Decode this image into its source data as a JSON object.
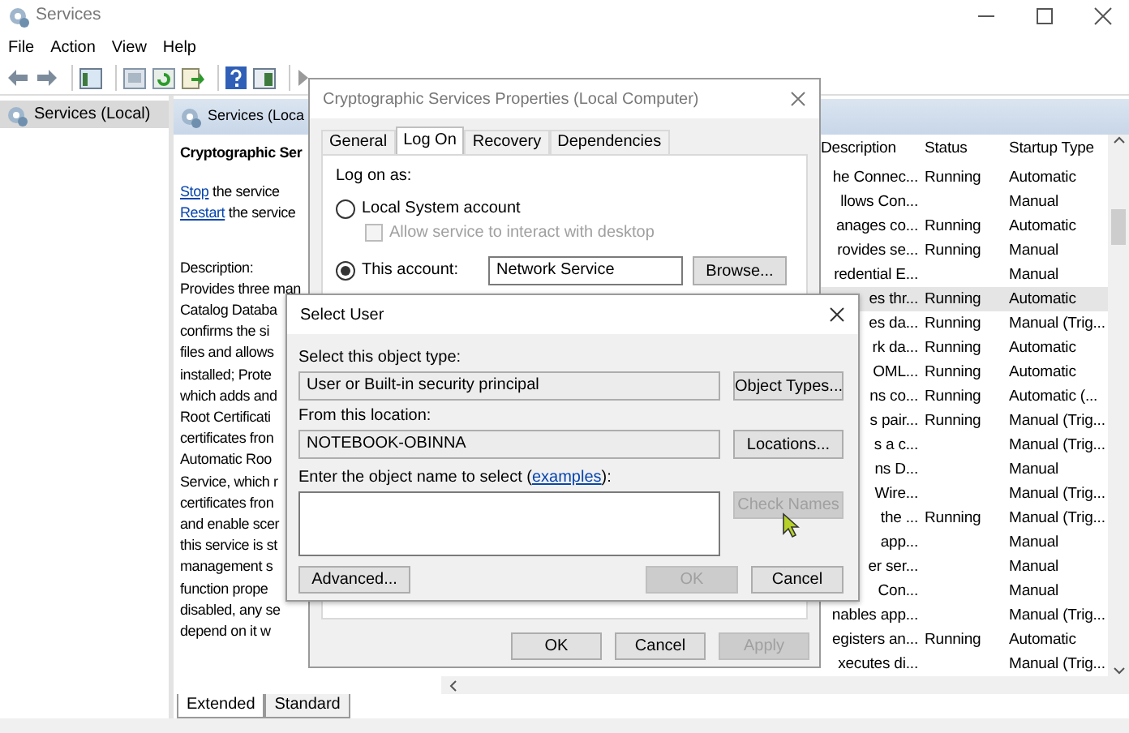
{
  "window": {
    "title": "Services"
  },
  "menu": [
    "File",
    "Action",
    "View",
    "Help"
  ],
  "tree": {
    "items": [
      {
        "label": "Services (Local)",
        "selected": true
      }
    ]
  },
  "pane_header": "Services (Loca",
  "details": {
    "title": "Cryptographic Ser",
    "actions": [
      {
        "link": "Stop",
        "text": "the service"
      },
      {
        "link": "Restart",
        "text": "the service"
      }
    ],
    "description_label": "Description:",
    "description_lines": [
      "Provides three man",
      "Catalog Databa",
      "confirms the si",
      "files and allows",
      "installed; Prote",
      "which adds and",
      "Root Certificati",
      "certificates fron",
      "Automatic Roo",
      "Service, which r",
      "certificates fron",
      "and enable scer",
      "this service is st",
      "management s",
      "function prope",
      "disabled, any se",
      "depend on it w"
    ]
  },
  "services_list": {
    "columns": [
      "Description",
      "Status",
      "Startup Type"
    ],
    "rows": [
      {
        "description": "he Connec...",
        "status": "Running",
        "startup_type": "Automatic",
        "selected": false
      },
      {
        "description": "llows Con...",
        "status": "",
        "startup_type": "Manual",
        "selected": false
      },
      {
        "description": "anages co...",
        "status": "Running",
        "startup_type": "Automatic",
        "selected": false
      },
      {
        "description": "rovides se...",
        "status": "Running",
        "startup_type": "Manual",
        "selected": false
      },
      {
        "description": "redential E...",
        "status": "",
        "startup_type": "Manual",
        "selected": false
      },
      {
        "description": "es thr...",
        "status": "Running",
        "startup_type": "Automatic",
        "selected": true
      },
      {
        "description": "es da...",
        "status": "Running",
        "startup_type": "Manual (Trig...",
        "selected": false
      },
      {
        "description": "rk da...",
        "status": "Running",
        "startup_type": "Automatic",
        "selected": false
      },
      {
        "description": "OML...",
        "status": "Running",
        "startup_type": "Automatic",
        "selected": false
      },
      {
        "description": "ns co...",
        "status": "Running",
        "startup_type": "Automatic (...",
        "selected": false
      },
      {
        "description": "s pair...",
        "status": "Running",
        "startup_type": "Manual (Trig...",
        "selected": false
      },
      {
        "description": "s a c...",
        "status": "",
        "startup_type": "Manual (Trig...",
        "selected": false
      },
      {
        "description": "ns D...",
        "status": "",
        "startup_type": "Manual",
        "selected": false
      },
      {
        "description": "Wire...",
        "status": "",
        "startup_type": "Manual (Trig...",
        "selected": false
      },
      {
        "description": "the ...",
        "status": "Running",
        "startup_type": "Manual (Trig...",
        "selected": false
      },
      {
        "description": "app...",
        "status": "",
        "startup_type": "Manual",
        "selected": false
      },
      {
        "description": "er ser...",
        "status": "",
        "startup_type": "Manual",
        "selected": false
      },
      {
        "description": "Con...",
        "status": "",
        "startup_type": "Manual",
        "selected": false
      },
      {
        "description": "nables app...",
        "status": "",
        "startup_type": "Manual (Trig...",
        "selected": false
      },
      {
        "description": "egisters an...",
        "status": "Running",
        "startup_type": "Automatic",
        "selected": false
      },
      {
        "description": "xecutes di...",
        "status": "",
        "startup_type": "Manual (Trig...",
        "selected": false
      }
    ]
  },
  "view_tabs": [
    {
      "label": "Extended",
      "selected": true
    },
    {
      "label": "Standard",
      "selected": false
    }
  ],
  "properties_dialog": {
    "title": "Cryptographic Services Properties (Local Computer)",
    "tabs": [
      {
        "label": "General",
        "selected": false
      },
      {
        "label": "Log On",
        "selected": true
      },
      {
        "label": "Recovery",
        "selected": false
      },
      {
        "label": "Dependencies",
        "selected": false
      }
    ],
    "log_on_label": "Log on as:",
    "local_system": {
      "label": "Local System account",
      "selected": false
    },
    "interact_checkbox": {
      "label": "Allow service to interact with desktop",
      "checked": false,
      "disabled": true
    },
    "this_account": {
      "label": "This account:",
      "selected": true,
      "value": "Network Service",
      "browse_button": "Browse..."
    },
    "buttons": [
      {
        "label": "OK",
        "disabled": false
      },
      {
        "label": "Cancel",
        "disabled": false
      },
      {
        "label": "Apply",
        "disabled": true
      }
    ]
  },
  "select_user_dialog": {
    "title": "Select User",
    "object_type_label": "Select this object type:",
    "object_type_value": "User or Built-in security principal",
    "object_types_button": {
      "label": "Object Types...",
      "disabled": false
    },
    "location_label": "From this location:",
    "location_value": "NOTEBOOK-OBINNA",
    "locations_button": {
      "label": "Locations...",
      "disabled": false
    },
    "name_label_before": "Enter the object name to select (",
    "name_label_link": "examples",
    "name_label_after": "):",
    "check_names_button": {
      "label": "Check Names",
      "disabled": true
    },
    "advanced_button": {
      "label": "Advanced...",
      "disabled": false
    },
    "buttons": [
      {
        "label": "OK",
        "disabled": true
      },
      {
        "label": "Cancel",
        "disabled": false
      }
    ]
  }
}
